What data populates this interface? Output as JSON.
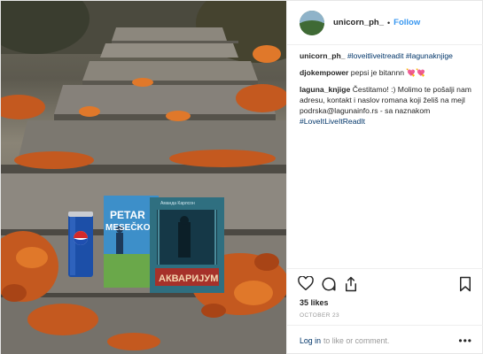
{
  "post": {
    "author": "unicorn_ph_",
    "separator": "•",
    "follow_label": "Follow"
  },
  "photo": {
    "book1": {
      "author_line": "PETAR",
      "title_line": "MESEČKO"
    },
    "book2": {
      "author_line": "Аманда Карлсон",
      "title_line": "АКВАРИЈУМ"
    },
    "can": {
      "brand": "pepsi"
    }
  },
  "comments": [
    {
      "user": "unicorn_ph_",
      "text": "#loveitliveitreadit #lagunaknjige"
    },
    {
      "user": "djokempower",
      "text": "pepsi je bitannn 💘💘"
    },
    {
      "user": "laguna_knjige",
      "text": "Čestitamo! :) Molimo te pošalji nam adresu, kontakt i naslov romana koji želiš na mejl podrska@lagunainfo.rs - sa naznakom ",
      "hashtag": "#LoveItLiveItReadIt"
    }
  ],
  "icons": {
    "like": "heart-icon",
    "comment": "comment-bubble-icon",
    "share": "share-icon",
    "save": "bookmark-icon",
    "more": "ellipsis-icon"
  },
  "likes": "35 likes",
  "date": "OCTOBER 23",
  "login": {
    "link": "Log in",
    "rest": "to like or comment.",
    "more": "•••"
  },
  "colors": {
    "link_blue": "#3897f0",
    "hashtag_blue": "#003569",
    "muted": "#999999",
    "border": "#efefef"
  }
}
